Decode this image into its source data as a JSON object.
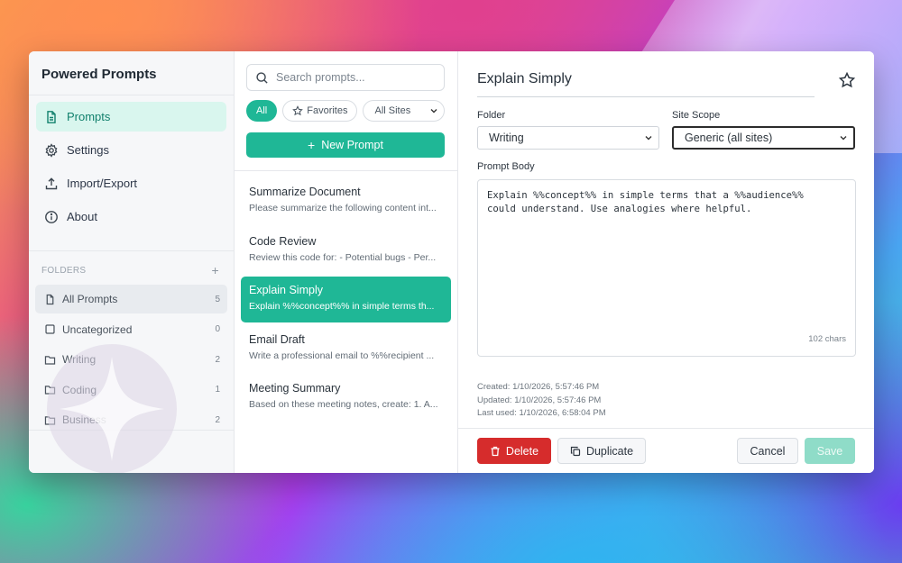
{
  "app": {
    "title": "Powered Prompts"
  },
  "nav": {
    "items": [
      {
        "label": "Prompts",
        "icon": "document-icon",
        "active": true
      },
      {
        "label": "Settings",
        "icon": "gear-icon",
        "active": false
      },
      {
        "label": "Import/Export",
        "icon": "upload-icon",
        "active": false
      },
      {
        "label": "About",
        "icon": "info-icon",
        "active": false
      }
    ]
  },
  "folders": {
    "header": "FOLDERS",
    "add_symbol": "+",
    "items": [
      {
        "label": "All Prompts",
        "count": "5",
        "icon": "document-icon",
        "active": true
      },
      {
        "label": "Uncategorized",
        "count": "0",
        "icon": "square-icon",
        "active": false
      },
      {
        "label": "Writing",
        "count": "2",
        "icon": "folder-icon",
        "active": false
      },
      {
        "label": "Coding",
        "count": "1",
        "icon": "folder-icon",
        "active": false
      },
      {
        "label": "Business",
        "count": "2",
        "icon": "folder-icon",
        "active": false
      }
    ]
  },
  "list": {
    "search_placeholder": "Search prompts...",
    "filters": {
      "all": "All",
      "favorites": "Favorites",
      "sites": "All Sites"
    },
    "new_button": "New Prompt",
    "new_symbol": "+",
    "items": [
      {
        "title": "Summarize Document",
        "preview": "Please summarize the following content int...",
        "active": false
      },
      {
        "title": "Code Review",
        "preview": "Review this code for: - Potential bugs - Per...",
        "active": false
      },
      {
        "title": "Explain Simply",
        "preview": "Explain %%concept%% in simple terms th...",
        "active": true
      },
      {
        "title": "Email Draft",
        "preview": "Write a professional email to %%recipient ...",
        "active": false
      },
      {
        "title": "Meeting Summary",
        "preview": "Based on these meeting notes, create: 1. A...",
        "active": false
      }
    ]
  },
  "editor": {
    "title": "Explain Simply",
    "folder_label": "Folder",
    "folder_value": "Writing",
    "scope_label": "Site Scope",
    "scope_value": "Generic (all sites)",
    "body_label": "Prompt Body",
    "body_text": "Explain %%concept%% in simple terms that a %%audience%%\ncould understand. Use analogies where helpful.",
    "char_count": "102 chars",
    "created": "Created: 1/10/2026, 5:57:46 PM",
    "updated": "Updated: 1/10/2026, 5:57:46 PM",
    "last_used": "Last used: 1/10/2026, 6:58:04 PM",
    "buttons": {
      "delete": "Delete",
      "duplicate": "Duplicate",
      "cancel": "Cancel",
      "save": "Save"
    }
  },
  "colors": {
    "accent": "#1fb796",
    "danger": "#d62c2c",
    "active_nav_bg": "#d9f6ee"
  }
}
